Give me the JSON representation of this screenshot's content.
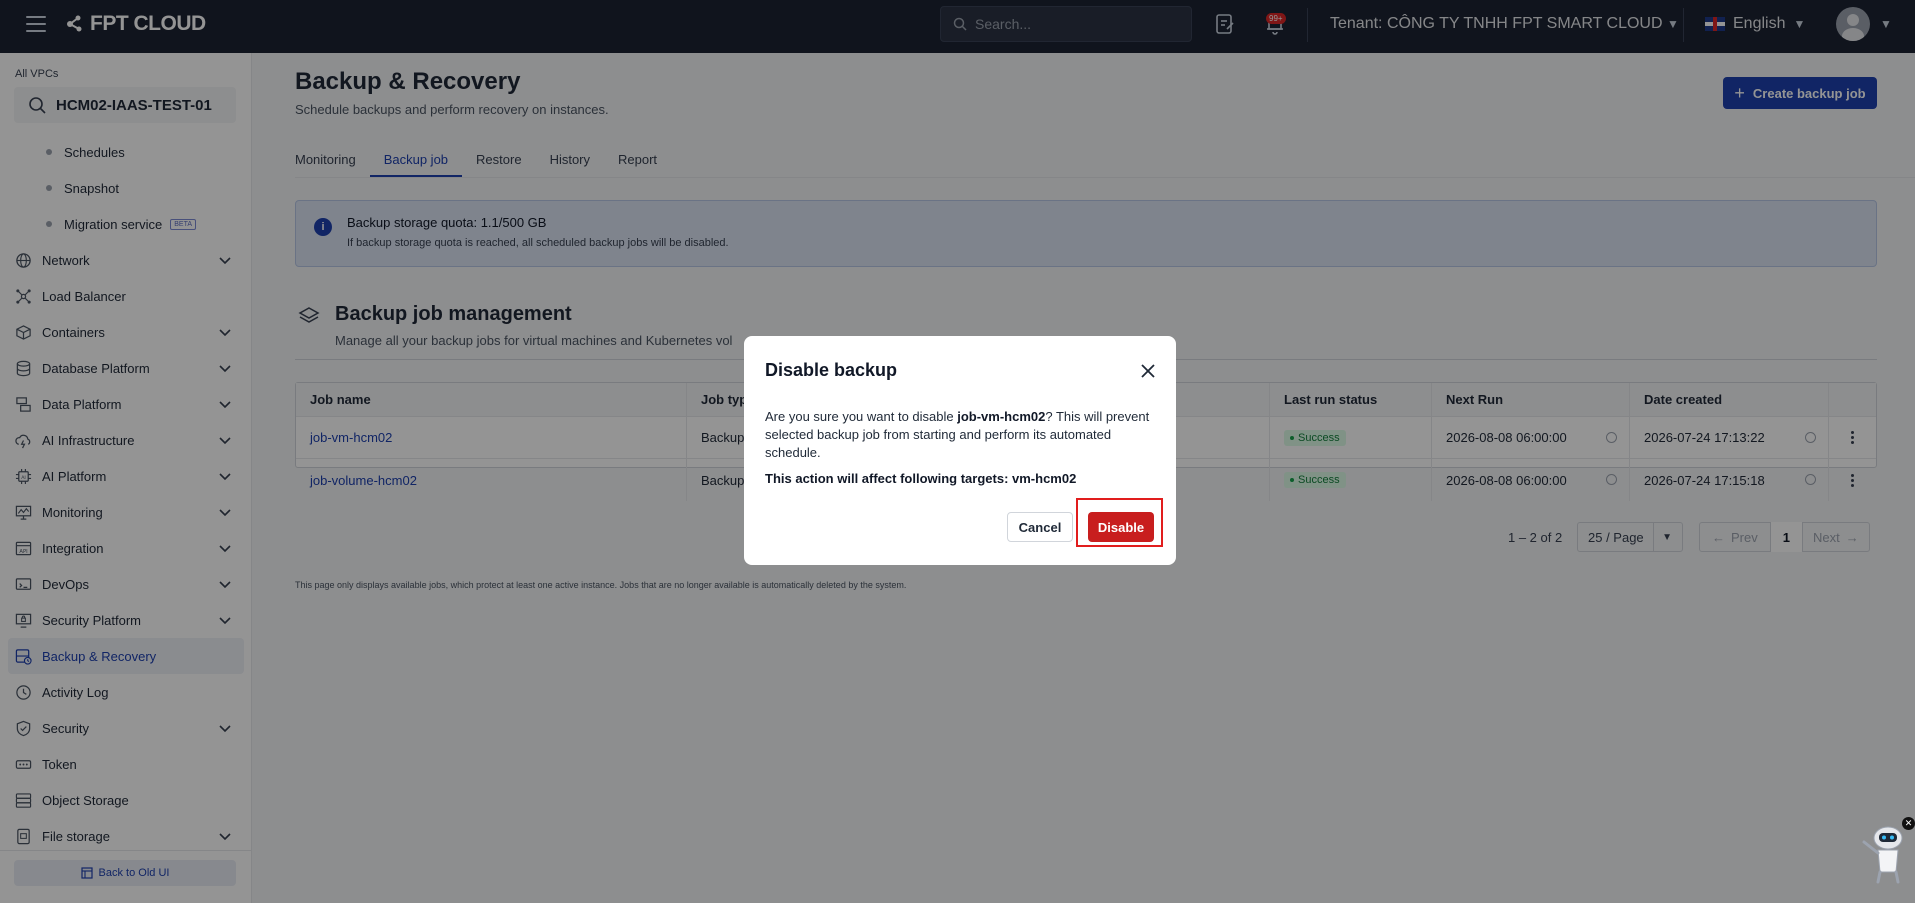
{
  "topbar": {
    "logo": "FPT CLOUD",
    "search_placeholder": "Search...",
    "notification_badge": "99+",
    "tenant_label": "Tenant:",
    "tenant_name": "CÔNG TY TNHH FPT SMART CLOUD",
    "language": "English"
  },
  "sidebar": {
    "vpc_label": "All VPCs",
    "vpc_name": "HCM02-IAAS-TEST-01",
    "subitems": [
      {
        "label": "Schedules"
      },
      {
        "label": "Snapshot"
      },
      {
        "label": "Migration service",
        "badge": "BETA"
      }
    ],
    "items": [
      {
        "label": "Network",
        "icon": "globe-icon",
        "expandable": true
      },
      {
        "label": "Load Balancer",
        "icon": "network-nodes-icon",
        "expandable": false
      },
      {
        "label": "Containers",
        "icon": "cube-icon",
        "expandable": true
      },
      {
        "label": "Database Platform",
        "icon": "database-icon",
        "expandable": true
      },
      {
        "label": "Data Platform",
        "icon": "data-stack-icon",
        "expandable": true
      },
      {
        "label": "AI Infrastructure",
        "icon": "cloud-bolt-icon",
        "expandable": true
      },
      {
        "label": "AI Platform",
        "icon": "ai-chip-icon",
        "expandable": true
      },
      {
        "label": "Monitoring",
        "icon": "monitor-chart-icon",
        "expandable": true
      },
      {
        "label": "Integration",
        "icon": "api-icon",
        "expandable": true
      },
      {
        "label": "DevOps",
        "icon": "devops-icon",
        "expandable": true
      },
      {
        "label": "Security Platform",
        "icon": "lock-screen-icon",
        "expandable": true
      },
      {
        "label": "Backup & Recovery",
        "icon": "backup-icon",
        "expandable": false,
        "active": true
      },
      {
        "label": "Activity Log",
        "icon": "clock-icon",
        "expandable": false
      },
      {
        "label": "Security",
        "icon": "shield-icon",
        "expandable": true
      },
      {
        "label": "Token",
        "icon": "token-icon",
        "expandable": false
      },
      {
        "label": "Object Storage",
        "icon": "storage-icon",
        "expandable": false
      },
      {
        "label": "File storage",
        "icon": "file-storage-icon",
        "expandable": true
      }
    ],
    "back_old_ui": "Back to Old UI"
  },
  "page": {
    "title": "Backup & Recovery",
    "subtitle": "Schedule backups and perform recovery on instances.",
    "create_button": "Create backup job",
    "tabs": [
      "Monitoring",
      "Backup job",
      "Restore",
      "History",
      "Report"
    ],
    "active_tab": "Backup job",
    "info_title": "Backup storage quota: 1.1/500 GB",
    "info_desc": "If backup storage quota is reached, all scheduled backup jobs will be disabled.",
    "section_title": "Backup job management",
    "section_sub": "Manage all your backup jobs for virtual machines and Kubernetes vol",
    "footer_note": "This page only displays available jobs, which protect at least one active instance. Jobs that are no longer available is automatically deleted by the system."
  },
  "table": {
    "headers": [
      "Job name",
      "Job typ",
      "",
      "Last run status",
      "Next Run",
      "Date created",
      ""
    ],
    "rows": [
      {
        "name": "job-vm-hcm02",
        "type": "Backup",
        "status": "Success",
        "next_run": "2026-08-08 06:00:00",
        "created": "2026-07-24 17:13:22"
      },
      {
        "name": "job-volume-hcm02",
        "type": "Backup",
        "status": "Success",
        "next_run": "2026-08-08 06:00:00",
        "created": "2026-07-24 17:15:18"
      }
    ]
  },
  "pager": {
    "range": "1 – 2 of 2",
    "per_page": "25 / Page",
    "prev": "Prev",
    "current": "1",
    "next": "Next"
  },
  "modal": {
    "title": "Disable backup",
    "body_pre": "Are you sure you want to disable ",
    "job_name": "job-vm-hcm02",
    "body_post": "? This will prevent selected backup job from starting and perform its automated schedule.",
    "warning": "This action will affect following targets: vm-hcm02",
    "cancel": "Cancel",
    "confirm": "Disable"
  },
  "colors": {
    "accent": "#1e40af",
    "danger": "#c81e1e",
    "topbar": "#1d2433",
    "success_bg": "#dcfce7"
  }
}
